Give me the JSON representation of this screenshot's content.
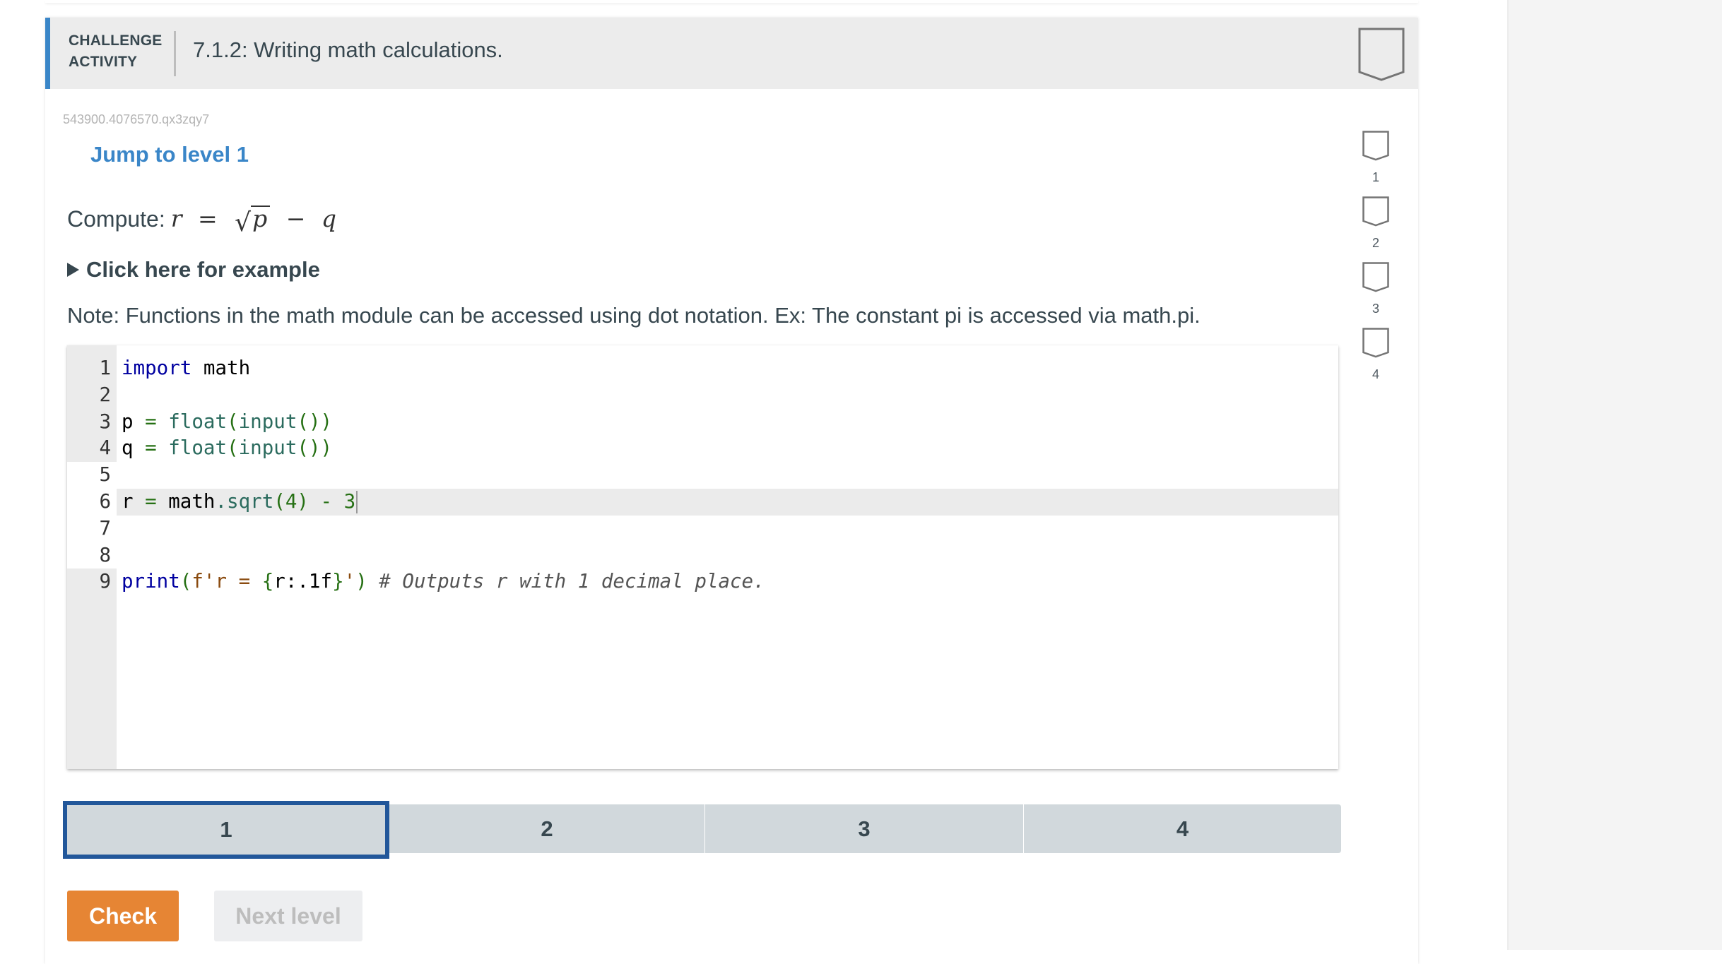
{
  "activity": {
    "type_line1": "CHALLENGE",
    "type_line2": "ACTIVITY",
    "title": "7.1.2: Writing math calculations.",
    "id": "543900.4076570.qx3zqy7",
    "jump_link": "Jump to level 1"
  },
  "prompt": {
    "compute_label": "Compute:",
    "formula": {
      "lhs": "r",
      "equals": "=",
      "radical": "√",
      "radicand": "p",
      "minus": "−",
      "rhs": "q"
    },
    "example_toggle": "Click here for example",
    "note": "Note: Functions in the math module can be accessed using dot notation. Ex: The constant pi is accessed via math.pi."
  },
  "editor": {
    "active_line": 6,
    "lines": [
      {
        "num": "1",
        "editable": false,
        "tokens": [
          {
            "t": "import",
            "c": "kw"
          },
          {
            "t": " math",
            "c": ""
          }
        ]
      },
      {
        "num": "2",
        "editable": false,
        "tokens": []
      },
      {
        "num": "3",
        "editable": false,
        "tokens": [
          {
            "t": "p ",
            "c": ""
          },
          {
            "t": "=",
            "c": "op"
          },
          {
            "t": " ",
            "c": ""
          },
          {
            "t": "float",
            "c": "fn"
          },
          {
            "t": "(",
            "c": "pn"
          },
          {
            "t": "input",
            "c": "fn"
          },
          {
            "t": "())",
            "c": "pn"
          }
        ]
      },
      {
        "num": "4",
        "editable": false,
        "tokens": [
          {
            "t": "q ",
            "c": ""
          },
          {
            "t": "=",
            "c": "op"
          },
          {
            "t": " ",
            "c": ""
          },
          {
            "t": "float",
            "c": "fn"
          },
          {
            "t": "(",
            "c": "pn"
          },
          {
            "t": "input",
            "c": "fn"
          },
          {
            "t": "())",
            "c": "pn"
          }
        ]
      },
      {
        "num": "5",
        "editable": true,
        "tokens": []
      },
      {
        "num": "6",
        "editable": true,
        "tokens": [
          {
            "t": "r ",
            "c": ""
          },
          {
            "t": "=",
            "c": "op"
          },
          {
            "t": " math",
            "c": ""
          },
          {
            "t": ".sqrt",
            "c": "fn"
          },
          {
            "t": "(4)",
            "c": "pn"
          },
          {
            "t": " - ",
            "c": "op"
          },
          {
            "t": "3",
            "c": "num"
          }
        ]
      },
      {
        "num": "7",
        "editable": true,
        "tokens": []
      },
      {
        "num": "8",
        "editable": true,
        "tokens": []
      },
      {
        "num": "9",
        "editable": false,
        "tokens": [
          {
            "t": "print",
            "c": "kw"
          },
          {
            "t": "(",
            "c": "pn"
          },
          {
            "t": "f'r = ",
            "c": "str"
          },
          {
            "t": "{",
            "c": "pn"
          },
          {
            "t": "r:.1f",
            "c": ""
          },
          {
            "t": "}",
            "c": "pn"
          },
          {
            "t": "'",
            "c": "str"
          },
          {
            "t": ")",
            "c": "pn"
          },
          {
            "t": " # Outputs r with 1 decimal place.",
            "c": "cm"
          }
        ]
      }
    ]
  },
  "levels": {
    "current": 1,
    "items": [
      "1",
      "2",
      "3",
      "4"
    ]
  },
  "badges": {
    "items": [
      "1",
      "2",
      "3",
      "4"
    ],
    "completed": 0,
    "total": 4
  },
  "buttons": {
    "check": "Check",
    "next_level": "Next level"
  },
  "colors": {
    "accent": "#3a86c8",
    "check": "#e68534",
    "level_outline": "#22579a",
    "level_bg": "#d1d8dc"
  }
}
